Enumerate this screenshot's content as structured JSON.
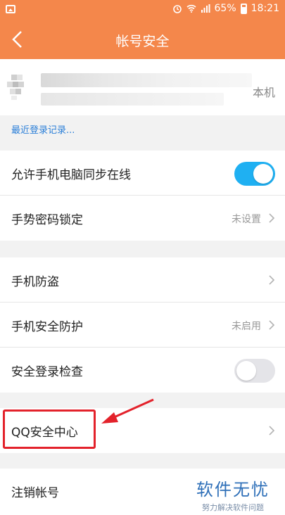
{
  "status_bar": {
    "battery": "65%",
    "time": "18:21"
  },
  "header": {
    "title": "帐号安全"
  },
  "device": {
    "tag": "本机"
  },
  "recent_login": "最近登录记录...",
  "group1": [
    {
      "label": "允许手机电脑同步在线",
      "toggle": "on"
    },
    {
      "label": "手势密码锁定",
      "value": "未设置"
    }
  ],
  "group2": [
    {
      "label": "手机防盗"
    },
    {
      "label": "手机安全防护",
      "value": "未启用"
    },
    {
      "label": "安全登录检查",
      "toggle": "off"
    }
  ],
  "group3": [
    {
      "label": "QQ安全中心"
    }
  ],
  "group4": [
    {
      "label": "注销帐号"
    }
  ],
  "watermark": {
    "title": "软件无忧",
    "subtitle": "努力解决软件问题"
  },
  "colors": {
    "header": "#f4874b",
    "toggle_on": "#1fb0f2",
    "link": "#2b7fd8",
    "annotation": "#e3222b"
  }
}
